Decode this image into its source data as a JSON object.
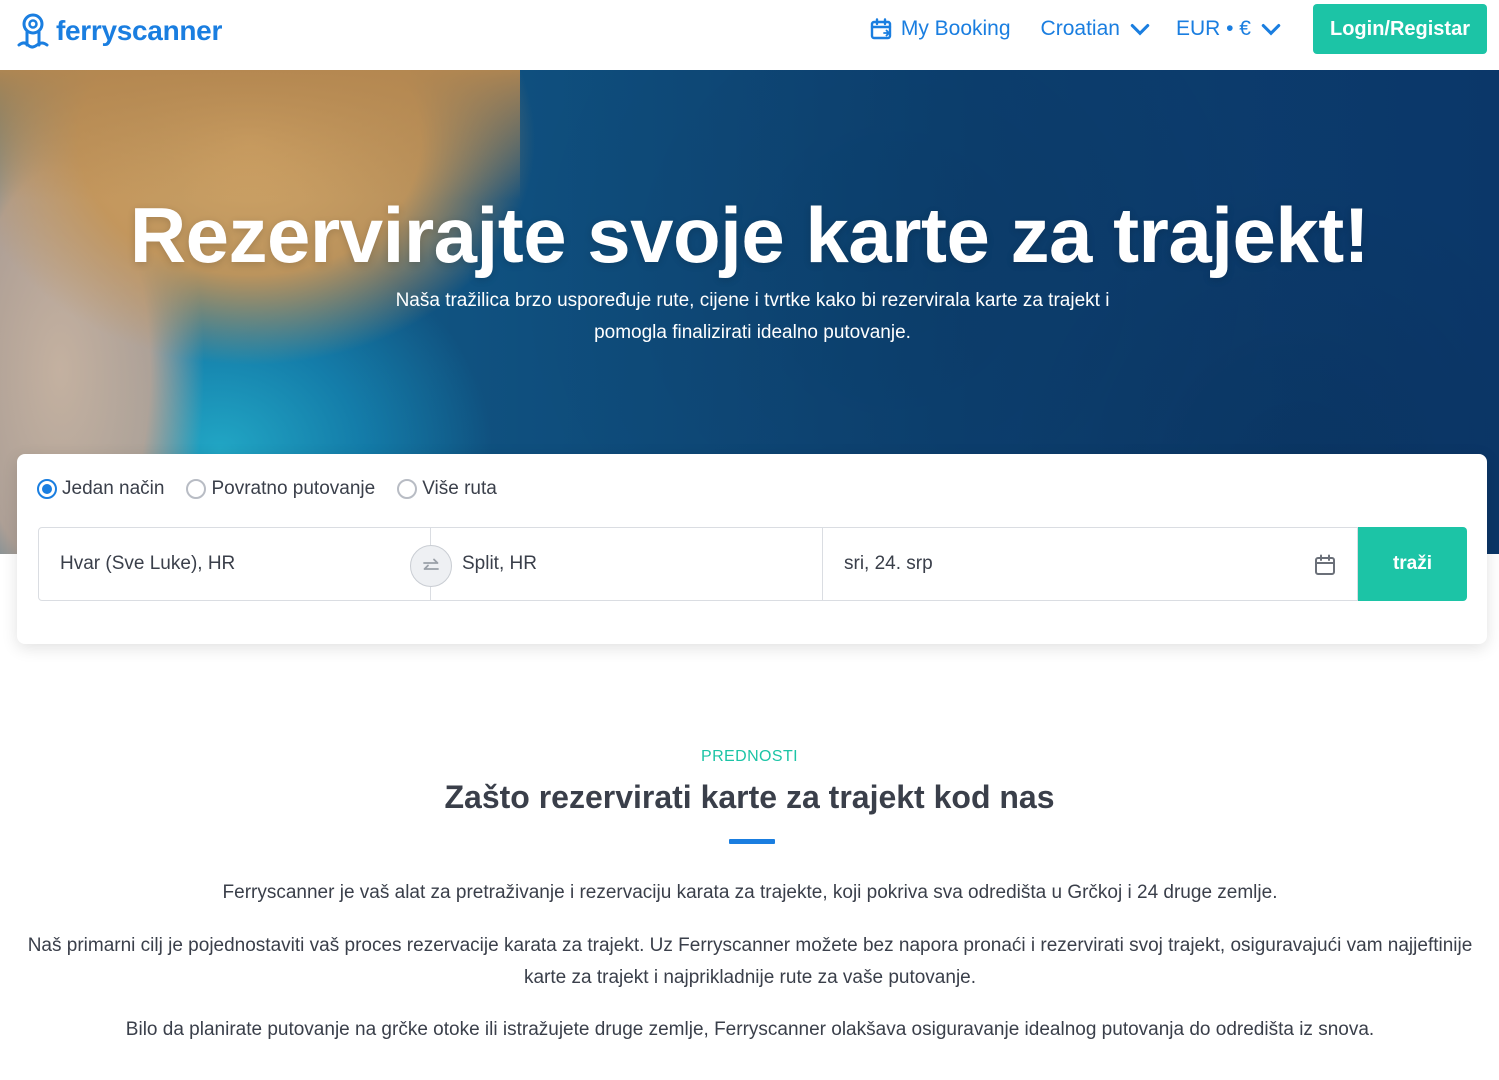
{
  "header": {
    "brand": "ferryscanner",
    "my_booking": "My Booking",
    "language": "Croatian",
    "currency": "EUR • €",
    "login": "Login/Registar"
  },
  "hero": {
    "title": "Rezervirajte svoje karte za trajekt!",
    "subtitle": "Naša tražilica brzo uspoređuje rute, cijene i tvrtke kako bi rezervirala karte za trajekt i pomogla finalizirati idealno putovanje."
  },
  "search": {
    "trip_types": [
      {
        "label": "Jedan način",
        "selected": true
      },
      {
        "label": "Povratno putovanje",
        "selected": false
      },
      {
        "label": "Više ruta",
        "selected": false
      }
    ],
    "from": "Hvar (Sve Luke), HR",
    "to": "Split, HR",
    "date": "sri, 24. srp",
    "button": "traži"
  },
  "advantages": {
    "eyebrow": "PREDNOSTI",
    "title": "Zašto rezervirati karte za trajekt kod nas",
    "paragraphs": [
      "Ferryscanner je vaš alat za pretraživanje i rezervaciju karata za trajekte, koji pokriva sva odredišta u Grčkoj i 24 druge zemlje.",
      "Naš primarni cilj je pojednostaviti vaš proces rezervacije karata za trajekt. Uz Ferryscanner možete bez napora pronaći i rezervirati svoj trajekt, osiguravajući vam najjeftinije karte za trajekt i najprikladnije rute za vaše putovanje.",
      "Bilo da planirate putovanje na grčke otoke ili istražujete druge zemlje, Ferryscanner olakšava osiguravanje idealnog putovanja do odredišta iz snova."
    ]
  },
  "colors": {
    "brand_blue": "#1a7ee0",
    "accent_teal": "#1cc4a6",
    "text": "#3a3f4a"
  },
  "icons": [
    "ferryscanner-logo-icon",
    "calendar-icon",
    "chevron-down-icon",
    "swap-icon",
    "calendar-icon"
  ]
}
